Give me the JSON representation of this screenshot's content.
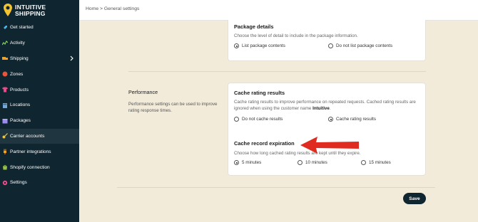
{
  "brand": {
    "line1": "INTUITIVE",
    "line2": "SHIPPING"
  },
  "sidebar": {
    "items": [
      {
        "label": "Get started",
        "icon": "rocket-icon"
      },
      {
        "label": "Activity",
        "icon": "activity-icon"
      },
      {
        "label": "Shipping",
        "icon": "shipping-icon"
      },
      {
        "label": "Zones",
        "icon": "globe-icon"
      },
      {
        "label": "Products",
        "icon": "shirt-icon"
      },
      {
        "label": "Locations",
        "icon": "building-icon"
      },
      {
        "label": "Packages",
        "icon": "box-icon"
      },
      {
        "label": "Carrier accounts",
        "icon": "key-icon"
      },
      {
        "label": "Partner integrations",
        "icon": "plug-icon"
      },
      {
        "label": "Shopify connection",
        "icon": "bag-icon"
      },
      {
        "label": "Settings",
        "icon": "gear-icon"
      }
    ]
  },
  "breadcrumb": "Home > General settings",
  "package_details": {
    "title": "Package details",
    "description": "Choose the level of detail to include in the package information.",
    "options": [
      "List package contents",
      "Do not list package contents"
    ]
  },
  "performance": {
    "title": "Performance",
    "description": "Performance settings can be used to improve rating response times."
  },
  "cache_results": {
    "title": "Cache rating results",
    "description_line1": "Cache rating results to improve performance on repeated requests. Cached rating results are",
    "description_line2_prefix": "ignored when using the customer name",
    "description_line2_bold": "Intuitive",
    "description_line2_suffix": ".",
    "options": [
      "Do not cache results",
      "Cache rating results"
    ]
  },
  "cache_expiration": {
    "title": "Cache record expiration",
    "description": "Choose how long cached rating results are kept until they expire.",
    "options": [
      "5 minutes",
      "10 minutes",
      "15 minutes"
    ]
  },
  "save_label": "Save",
  "colors": {
    "sidebar": "#0f2530",
    "page_bg": "#f3ebda",
    "arrow": "#e02b20"
  }
}
